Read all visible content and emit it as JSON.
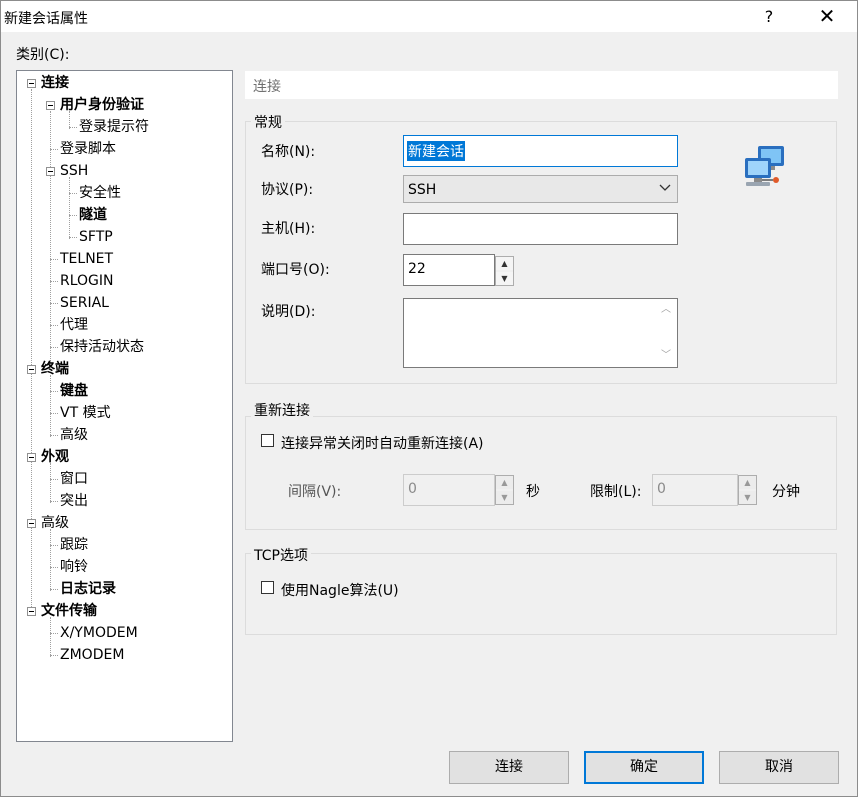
{
  "window": {
    "title": "新建会话属性",
    "help_glyph": "?",
    "close_glyph": "✕"
  },
  "category_label": "类别(C):",
  "tree": [
    {
      "label": "连接",
      "bold": true
    },
    {
      "label": "用户身份验证",
      "bold": true
    },
    {
      "label": "登录提示符",
      "bold": false
    },
    {
      "label": "登录脚本",
      "bold": false
    },
    {
      "label": "SSH",
      "bold": false
    },
    {
      "label": "安全性",
      "bold": false
    },
    {
      "label": "隧道",
      "bold": true
    },
    {
      "label": "SFTP",
      "bold": false
    },
    {
      "label": "TELNET",
      "bold": false
    },
    {
      "label": "RLOGIN",
      "bold": false
    },
    {
      "label": "SERIAL",
      "bold": false
    },
    {
      "label": "代理",
      "bold": false
    },
    {
      "label": "保持活动状态",
      "bold": false
    },
    {
      "label": "终端",
      "bold": true
    },
    {
      "label": "键盘",
      "bold": true
    },
    {
      "label": "VT 模式",
      "bold": false
    },
    {
      "label": "高级",
      "bold": false
    },
    {
      "label": "外观",
      "bold": true
    },
    {
      "label": "窗口",
      "bold": false
    },
    {
      "label": "突出",
      "bold": false
    },
    {
      "label": "高级",
      "bold": false
    },
    {
      "label": "跟踪",
      "bold": false
    },
    {
      "label": "响铃",
      "bold": false
    },
    {
      "label": "日志记录",
      "bold": true
    },
    {
      "label": "文件传输",
      "bold": true
    },
    {
      "label": "X/YMODEM",
      "bold": false
    },
    {
      "label": "ZMODEM",
      "bold": false
    }
  ],
  "section_header": "连接",
  "general": {
    "title": "常规",
    "name_label": "名称(N):",
    "name_value": "新建会话",
    "protocol_label": "协议(P):",
    "protocol_value": "SSH",
    "host_label": "主机(H):",
    "host_value": "",
    "port_label": "端口号(O):",
    "port_value": "22",
    "desc_label": "说明(D):",
    "desc_value": ""
  },
  "reconnect": {
    "title": "重新连接",
    "checkbox_label": "连接异常关闭时自动重新连接(A)",
    "checked": false,
    "interval_label": "间隔(V):",
    "interval_value": "0",
    "interval_unit": "秒",
    "limit_label": "限制(L):",
    "limit_value": "0",
    "limit_unit": "分钟"
  },
  "tcp": {
    "title": "TCP选项",
    "nagle_label": "使用Nagle算法(U)",
    "checked": false
  },
  "buttons": {
    "connect": "连接",
    "ok": "确定",
    "cancel": "取消"
  },
  "icons": {
    "network": "network-computers-icon",
    "expand": "minus-box-icon"
  },
  "colors": {
    "accent": "#0078d7",
    "background": "#f0f0f0"
  }
}
